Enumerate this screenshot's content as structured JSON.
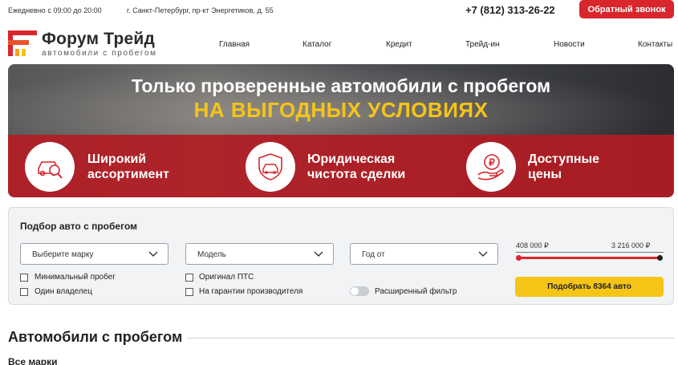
{
  "topbar": {
    "hours": "Ежедневно с 09:00 до 20:00",
    "address": "г. Санкт-Петербург, пр-кт Энергетиков, д. 55",
    "phone": "+7 (812) 313-26-22",
    "callback_label": "Обратный звонок"
  },
  "logo": {
    "title": "Форум Трейд",
    "subtitle": "автомобили с пробегом"
  },
  "nav": [
    "Главная",
    "Каталог",
    "Кредит",
    "Трейд-ин",
    "Новости",
    "Контакты"
  ],
  "hero": {
    "line1": "Только проверенные автомобили с пробегом",
    "line2": "НА ВЫГОДНЫХ УСЛОВИЯХ",
    "features": [
      {
        "line1": "Широкий",
        "line2": "ассортимент",
        "icon": "car-search-icon"
      },
      {
        "line1": "Юридическая",
        "line2": "чистота сделки",
        "icon": "car-shield-icon"
      },
      {
        "line1": "Доступные",
        "line2": "цены",
        "icon": "ruble-hand-icon"
      }
    ]
  },
  "filter": {
    "title": "Подбор авто с пробегом",
    "brand_select": "Выберите марку",
    "model_select": "Модель",
    "year_select": "Год от",
    "checks": [
      "Минимальный пробег",
      "Один владелец",
      "Оригинал ПТС",
      "На гарантии производителя"
    ],
    "extended_filter": "Расширенный фильтр",
    "price_min": "408 000 ₽",
    "price_max": "3 216 000 ₽",
    "submit_label": "Подобрать 8364 авто"
  },
  "section": {
    "title": "Автомобили с пробегом",
    "subtitle": "Все марки"
  },
  "colors": {
    "brand_red": "#d8262c",
    "accent_yellow": "#f5c518"
  }
}
